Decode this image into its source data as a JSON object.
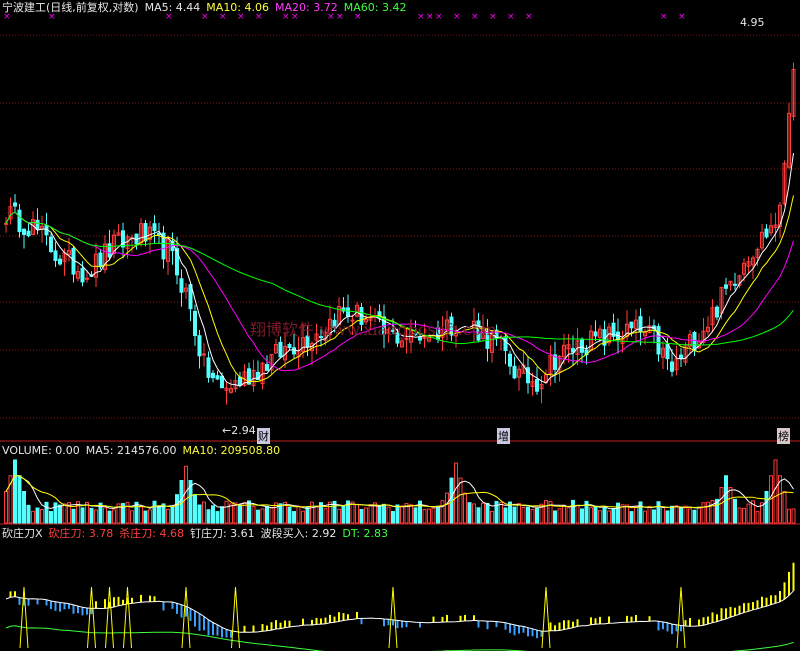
{
  "header": {
    "title": "宁波建工(日线,前复权,对数)",
    "ma5": "MA5: 4.44",
    "ma10": "MA10: 4.06",
    "ma20": "MA20: 3.72",
    "ma60": "MA60: 3.42"
  },
  "volume_header": {
    "volume": "VOLUME: 0.00",
    "ma5": "MA5: 214576.00",
    "ma10": "MA10: 209508.80"
  },
  "indicator_header": {
    "name": "砍庄刀X",
    "kan": "砍庄刀: 3.78",
    "sha": "杀庄刀: 4.68",
    "ding": "钉庄刀: 3.61",
    "boduan": "波段买入: 2.92",
    "dt": "DT: 2.83"
  },
  "labels": {
    "high": "4.95",
    "low": "2.94"
  },
  "events": [
    {
      "text": "财",
      "index": 57
    },
    {
      "text": "增",
      "index": 109
    },
    {
      "text": "榜",
      "index": 171
    }
  ],
  "watermark": "翔博软件 www.xiangbosoft.com",
  "colors": {
    "up": "#ff3c3c",
    "down": "#54ffff",
    "ma5": "#ffffff",
    "ma10": "#ffff00",
    "ma20": "#ff00ff",
    "ma60": "#00ff00",
    "grid": "#8a1010"
  },
  "chart_data": [
    {
      "type": "candlestick",
      "scale": "log",
      "ylim": [
        2.9,
        5.0
      ],
      "series": [
        {
          "name": "MA5",
          "color": "#ffffff"
        },
        {
          "name": "MA10",
          "color": "#ffff00"
        },
        {
          "name": "MA20",
          "color": "#ff00ff"
        },
        {
          "name": "MA60",
          "color": "#00ff00"
        }
      ],
      "anchors": [
        {
          "i": 0,
          "p": 3.85
        },
        {
          "i": 6,
          "p": 3.78
        },
        {
          "i": 12,
          "p": 3.62
        },
        {
          "i": 18,
          "p": 3.55
        },
        {
          "i": 24,
          "p": 3.68
        },
        {
          "i": 30,
          "p": 3.74
        },
        {
          "i": 36,
          "p": 3.66
        },
        {
          "i": 40,
          "p": 3.45
        },
        {
          "i": 44,
          "p": 3.12
        },
        {
          "i": 48,
          "p": 3.02
        },
        {
          "i": 52,
          "p": 3.06
        },
        {
          "i": 58,
          "p": 3.14
        },
        {
          "i": 64,
          "p": 3.22
        },
        {
          "i": 70,
          "p": 3.28
        },
        {
          "i": 74,
          "p": 3.36
        },
        {
          "i": 80,
          "p": 3.34
        },
        {
          "i": 84,
          "p": 3.26
        },
        {
          "i": 90,
          "p": 3.25
        },
        {
          "i": 96,
          "p": 3.28
        },
        {
          "i": 100,
          "p": 3.32
        },
        {
          "i": 104,
          "p": 3.3
        },
        {
          "i": 110,
          "p": 3.2
        },
        {
          "i": 114,
          "p": 3.08
        },
        {
          "i": 118,
          "p": 3.06
        },
        {
          "i": 122,
          "p": 3.16
        },
        {
          "i": 128,
          "p": 3.22
        },
        {
          "i": 134,
          "p": 3.25
        },
        {
          "i": 140,
          "p": 3.28
        },
        {
          "i": 144,
          "p": 3.24
        },
        {
          "i": 148,
          "p": 3.1
        },
        {
          "i": 152,
          "p": 3.22
        },
        {
          "i": 156,
          "p": 3.32
        },
        {
          "i": 160,
          "p": 3.46
        },
        {
          "i": 164,
          "p": 3.62
        },
        {
          "i": 168,
          "p": 3.72
        },
        {
          "i": 172,
          "p": 3.84
        },
        {
          "i": 175,
          "p": 4.75
        }
      ],
      "gaps": [
        [
          94,
          96
        ],
        [
          100,
          104
        ]
      ],
      "xlabel": "",
      "ylabel": ""
    },
    {
      "type": "bar",
      "series": [
        {
          "name": "MA5",
          "color": "#ffffff"
        },
        {
          "name": "MA10",
          "color": "#ffff00"
        }
      ],
      "peaks": [
        {
          "i": 2,
          "v": 1.0
        },
        {
          "i": 40,
          "v": 0.9
        },
        {
          "i": 100,
          "v": 0.95
        },
        {
          "i": 160,
          "v": 0.75
        },
        {
          "i": 171,
          "v": 1.0
        }
      ]
    },
    {
      "type": "line",
      "series": [
        {
          "name": "砍庄刀",
          "color": "#ff3c3c"
        },
        {
          "name": "杀庄刀",
          "color": "#ff3c3c"
        },
        {
          "name": "钉庄刀",
          "color": "#ffffff"
        },
        {
          "name": "波段买入",
          "color": "#ffffff"
        },
        {
          "name": "DT",
          "color": "#3cff3c"
        }
      ],
      "spikes": [
        4,
        19,
        23,
        27,
        40,
        51,
        86,
        120,
        150
      ]
    }
  ]
}
